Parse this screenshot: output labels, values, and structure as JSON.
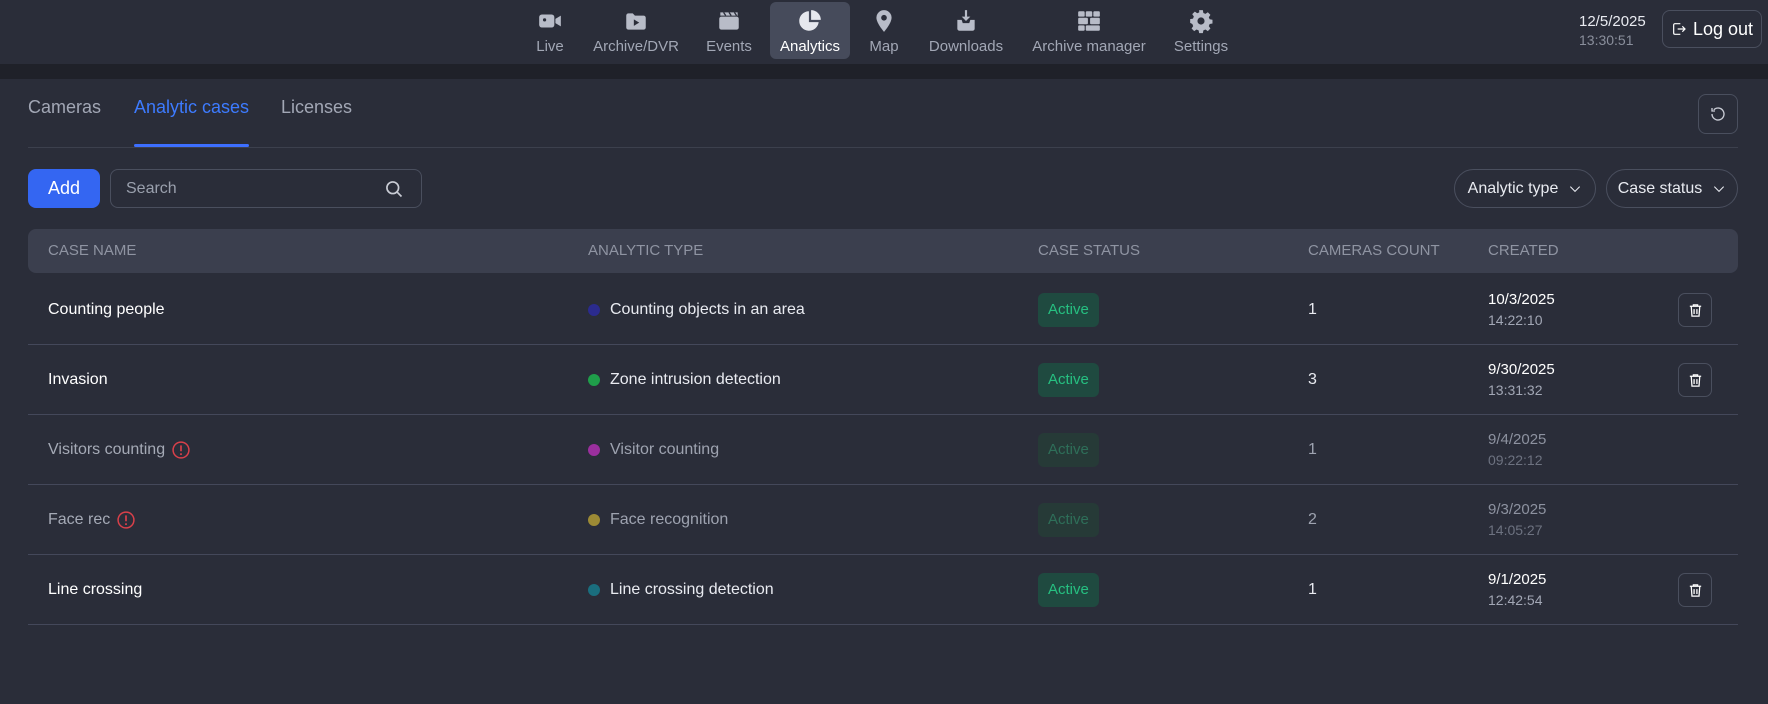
{
  "nav": {
    "items": [
      {
        "label": "Live",
        "icon": "camera-icon"
      },
      {
        "label": "Archive/DVR",
        "icon": "archive-folder-icon"
      },
      {
        "label": "Events",
        "icon": "clapperboard-icon"
      },
      {
        "label": "Analytics",
        "icon": "pie-chart-icon",
        "active": true
      },
      {
        "label": "Map",
        "icon": "map-pin-icon"
      },
      {
        "label": "Downloads",
        "icon": "download-box-icon"
      },
      {
        "label": "Archive manager",
        "icon": "grid-layout-icon"
      },
      {
        "label": "Settings",
        "icon": "gear-icon"
      }
    ]
  },
  "header": {
    "date": "12/5/2025",
    "time": "13:30:51",
    "logout_label": "Log out"
  },
  "tabs": [
    {
      "label": "Cameras"
    },
    {
      "label": "Analytic cases",
      "active": true
    },
    {
      "label": "Licenses"
    }
  ],
  "toolbar": {
    "add_label": "Add",
    "search_placeholder": "Search",
    "analytic_type_label": "Analytic type",
    "case_status_label": "Case status"
  },
  "table": {
    "columns": [
      "CASE NAME",
      "ANALYTIC TYPE",
      "CASE STATUS",
      "CAMERAS COUNT",
      "CREATED"
    ],
    "rows": [
      {
        "name": "Counting people",
        "warning": false,
        "type": "Counting objects in an area",
        "type_color": "#2b2b8e",
        "status": "Active",
        "cameras": "1",
        "created_date": "10/3/2025",
        "created_time": "14:22:10",
        "deletable": true,
        "disabled": false
      },
      {
        "name": "Invasion",
        "warning": false,
        "type": "Zone intrusion detection",
        "type_color": "#1f9e4a",
        "status": "Active",
        "cameras": "3",
        "created_date": "9/30/2025",
        "created_time": "13:31:32",
        "deletable": true,
        "disabled": false
      },
      {
        "name": "Visitors counting",
        "warning": true,
        "type": "Visitor counting",
        "type_color": "#9b2f9e",
        "status": "Active",
        "cameras": "1",
        "created_date": "9/4/2025",
        "created_time": "09:22:12",
        "deletable": false,
        "disabled": true
      },
      {
        "name": "Face rec",
        "warning": true,
        "type": "Face recognition",
        "type_color": "#9c8a35",
        "status": "Active",
        "cameras": "2",
        "created_date": "9/3/2025",
        "created_time": "14:05:27",
        "deletable": false,
        "disabled": true
      },
      {
        "name": "Line crossing",
        "warning": false,
        "type": "Line crossing detection",
        "type_color": "#1a6e7e",
        "status": "Active",
        "cameras": "1",
        "created_date": "9/1/2025",
        "created_time": "12:42:54",
        "deletable": true,
        "disabled": false
      }
    ]
  },
  "colors": {
    "accent": "#3466f2",
    "active_status": "#26c081",
    "warning": "#d9404a"
  }
}
